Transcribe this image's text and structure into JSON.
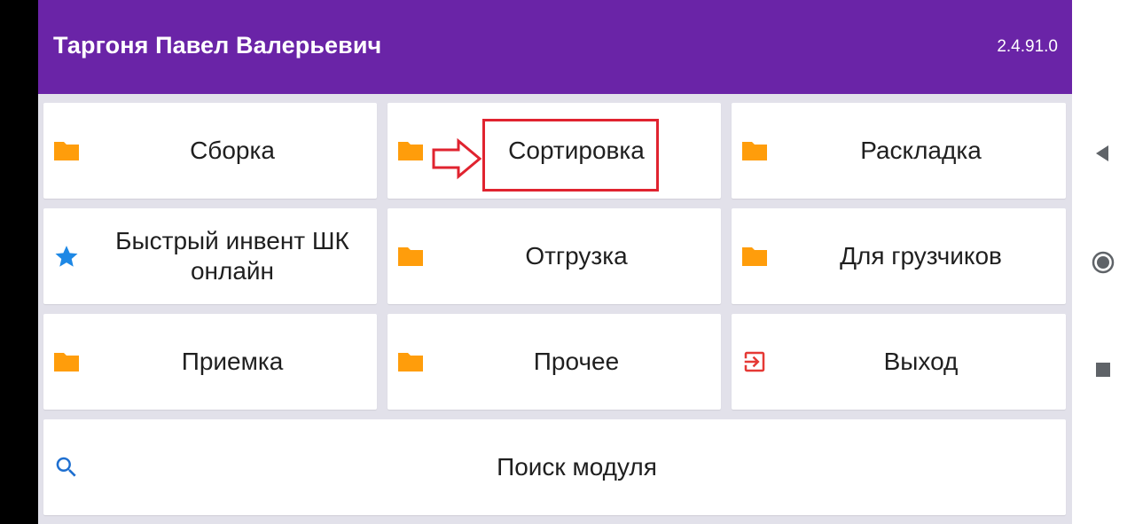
{
  "header": {
    "title": "Таргоня Павел Валерьевич",
    "version": "2.4.91.0"
  },
  "tiles": [
    {
      "label": "Сборка",
      "icon": "folder-icon"
    },
    {
      "label": "Сортировка",
      "icon": "folder-icon"
    },
    {
      "label": "Раскладка",
      "icon": "folder-icon"
    },
    {
      "label": "Быстрый инвент ШК онлайн",
      "icon": "star-icon"
    },
    {
      "label": "Отгрузка",
      "icon": "folder-icon"
    },
    {
      "label": "Для грузчиков",
      "icon": "folder-icon"
    },
    {
      "label": "Приемка",
      "icon": "folder-icon"
    },
    {
      "label": "Прочее",
      "icon": "folder-icon"
    },
    {
      "label": "Выход",
      "icon": "exit-icon"
    },
    {
      "label": "Поиск модуля",
      "icon": "search-icon"
    }
  ],
  "navigation_bar": {
    "buttons": [
      "back-icon",
      "home-icon",
      "recents-icon"
    ]
  },
  "colors": {
    "appbar": "#6a24a7",
    "folder": "#ff9d0b",
    "star": "#1e88e5",
    "exit": "#e53935",
    "search": "#1e6fd0",
    "highlight": "#e0232f"
  }
}
